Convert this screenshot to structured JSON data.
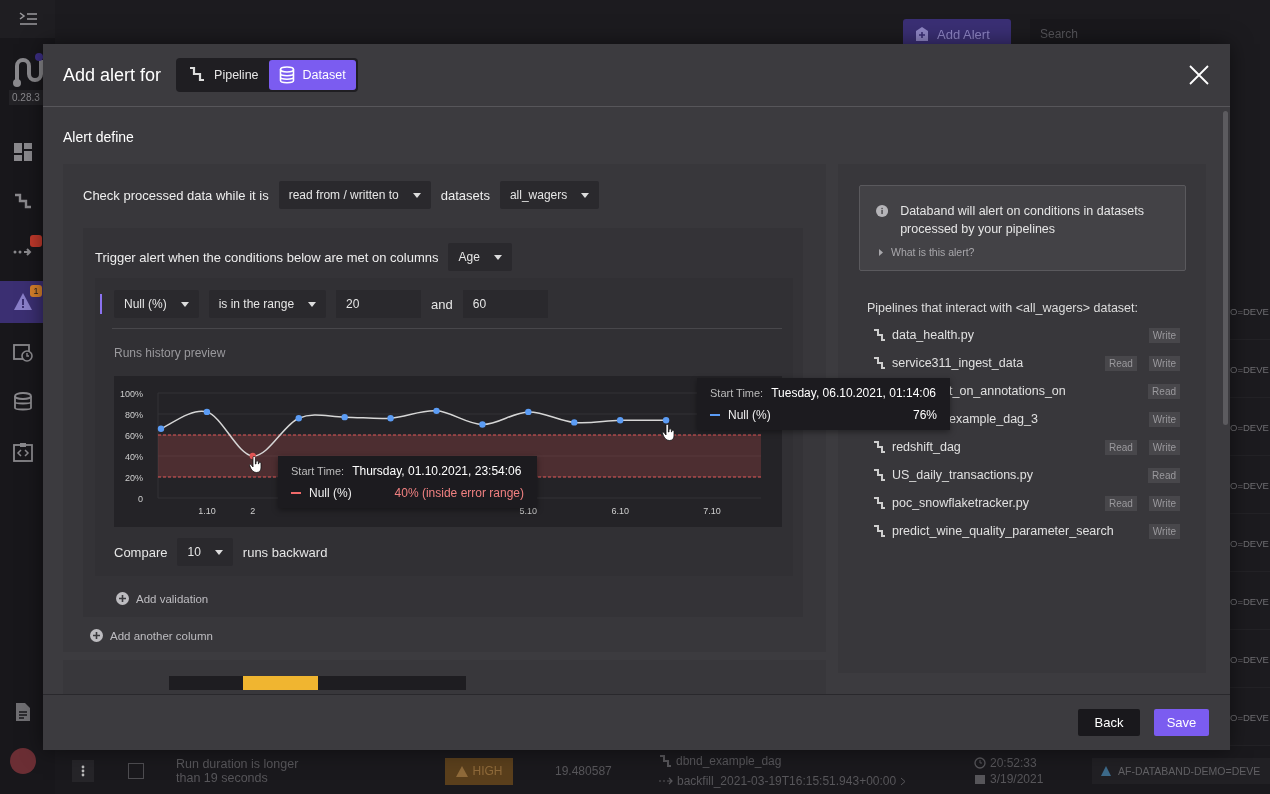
{
  "app": {
    "version": "0.28.3",
    "nav": [
      {
        "kind": "dashboard",
        "selected": false
      },
      {
        "kind": "pipeline",
        "selected": false
      },
      {
        "kind": "flow",
        "selected": false,
        "badge": {
          "color": "#c0392b"
        }
      },
      {
        "kind": "alerts",
        "selected": true,
        "badge": {
          "text": "1",
          "color": "#d9822b"
        }
      },
      {
        "kind": "schedule",
        "selected": false
      },
      {
        "kind": "datasets",
        "selected": false
      },
      {
        "kind": "code",
        "selected": false
      }
    ],
    "nav_bottom": [
      {
        "kind": "docs"
      },
      {
        "kind": "avatar"
      }
    ]
  },
  "header": {
    "add_button": "Add Alert",
    "search": {
      "placeholder": "Search"
    }
  },
  "background_cells": [
    "O=DEVE",
    "O=DEVE",
    "O=DEVE",
    "O=DEVE",
    "O=DEVE",
    "O=DEVE",
    "O=DEVE",
    "O=DEVE"
  ],
  "background_run": {
    "checked": false,
    "title": "Run duration is longer than 19 seconds",
    "severity": "HIGH",
    "value": "19.480587",
    "pipeline": "dbnd_example_dag",
    "run": "backfill_2021-03-19T16:15:51.943+00:00",
    "time": "20:52:33",
    "date": "3/19/2021",
    "env": "AF-DATABAND-DEMO=DEVE"
  },
  "modal": {
    "title": "Add alert for",
    "target_toggle": [
      {
        "kind": "pipeline",
        "label": "Pipeline",
        "selected": false
      },
      {
        "kind": "dataset",
        "label": "Dataset",
        "selected": true
      }
    ],
    "section_title": "Alert define",
    "check_row": {
      "prefix": "Check processed data while it is",
      "mode": "read from / written to",
      "datasets_label": "datasets",
      "dataset": "all_wagers"
    },
    "trigger": {
      "text": "Trigger alert when the conditions below are met on columns",
      "column": "Age"
    },
    "condition": {
      "metric": "Null (%)",
      "operator": "is in the range",
      "min": "20",
      "joiner": "and",
      "max": "60"
    },
    "preview_title": "Runs history preview",
    "chart_data": {
      "type": "line",
      "categories": [
        null,
        "1.10",
        "2",
        null,
        null,
        null,
        null,
        null,
        "5.10",
        null,
        "6.10",
        null,
        "7.10"
      ],
      "grid": true,
      "series": [
        {
          "name": "Null (%)",
          "color": "#d6d6d6",
          "marker": true,
          "values": [
            66,
            82,
            40,
            76,
            77,
            76,
            83,
            70,
            82,
            72,
            74,
            74,
            null
          ]
        }
      ],
      "ylim": [
        0,
        100
      ],
      "yticks": [
        {
          "value": 0,
          "label": "0"
        },
        {
          "value": 20,
          "label": "20%"
        },
        {
          "value": 40,
          "label": "40%"
        },
        {
          "value": 60,
          "label": "60%"
        },
        {
          "value": 80,
          "label": "80%"
        },
        {
          "value": 100,
          "label": "100%"
        }
      ],
      "bands": [
        {
          "axis": "y",
          "from": 20,
          "to": 60,
          "color": "#e05555"
        }
      ]
    },
    "tooltips": [
      {
        "kind": "error",
        "label": "Start Time:",
        "time": "Thursday, 01.10.2021, 23:54:06",
        "value": "40% (inside error range)"
      },
      {
        "kind": "normal",
        "label": "Start Time:",
        "time": "Tuesday, 06.10.2021, 01:14:06",
        "value": "76%"
      }
    ],
    "compare": {
      "label": "Compare",
      "count": "10",
      "suffix": "runs backward"
    },
    "add_validation": "Add validation",
    "add_column": "Add another column",
    "next_section": {
      "options": [
        {
          "selected": false
        },
        {
          "selected": true
        },
        {
          "selected": false
        },
        {
          "selected": false
        }
      ]
    },
    "info": {
      "text": "Databand will alert on conditions in datasets processed by your pipelines",
      "link": "What is this alert?",
      "expanded": false
    },
    "pipelines_title": "Pipelines that interact with <all_wagers> dataset:",
    "pipelines": [
      {
        "kind": "full",
        "name": "data_health.py",
        "tags": [
          "Write"
        ]
      },
      {
        "kind": "full",
        "name": "service311_ingest_data",
        "tags": [
          "Read",
          "Write"
        ]
      },
      {
        "kind": "partial",
        "name": "t_on_annotations_on",
        "tags": [
          "Read"
        ]
      },
      {
        "kind": "partial",
        "name": "example_dag_3",
        "tags": [
          "Write"
        ]
      },
      {
        "kind": "full",
        "name": "redshift_dag",
        "tags": [
          "Read",
          "Write"
        ]
      },
      {
        "kind": "full",
        "name": "US_daily_transactions.py",
        "tags": [
          "Read"
        ]
      },
      {
        "kind": "full",
        "name": "poc_snowflaketracker.py",
        "tags": [
          "Read",
          "Write"
        ]
      },
      {
        "kind": "full",
        "name": "predict_wine_quality_parameter_search",
        "tags": [
          "Write"
        ]
      }
    ],
    "footer": {
      "back": "Back",
      "save": "Save"
    }
  }
}
